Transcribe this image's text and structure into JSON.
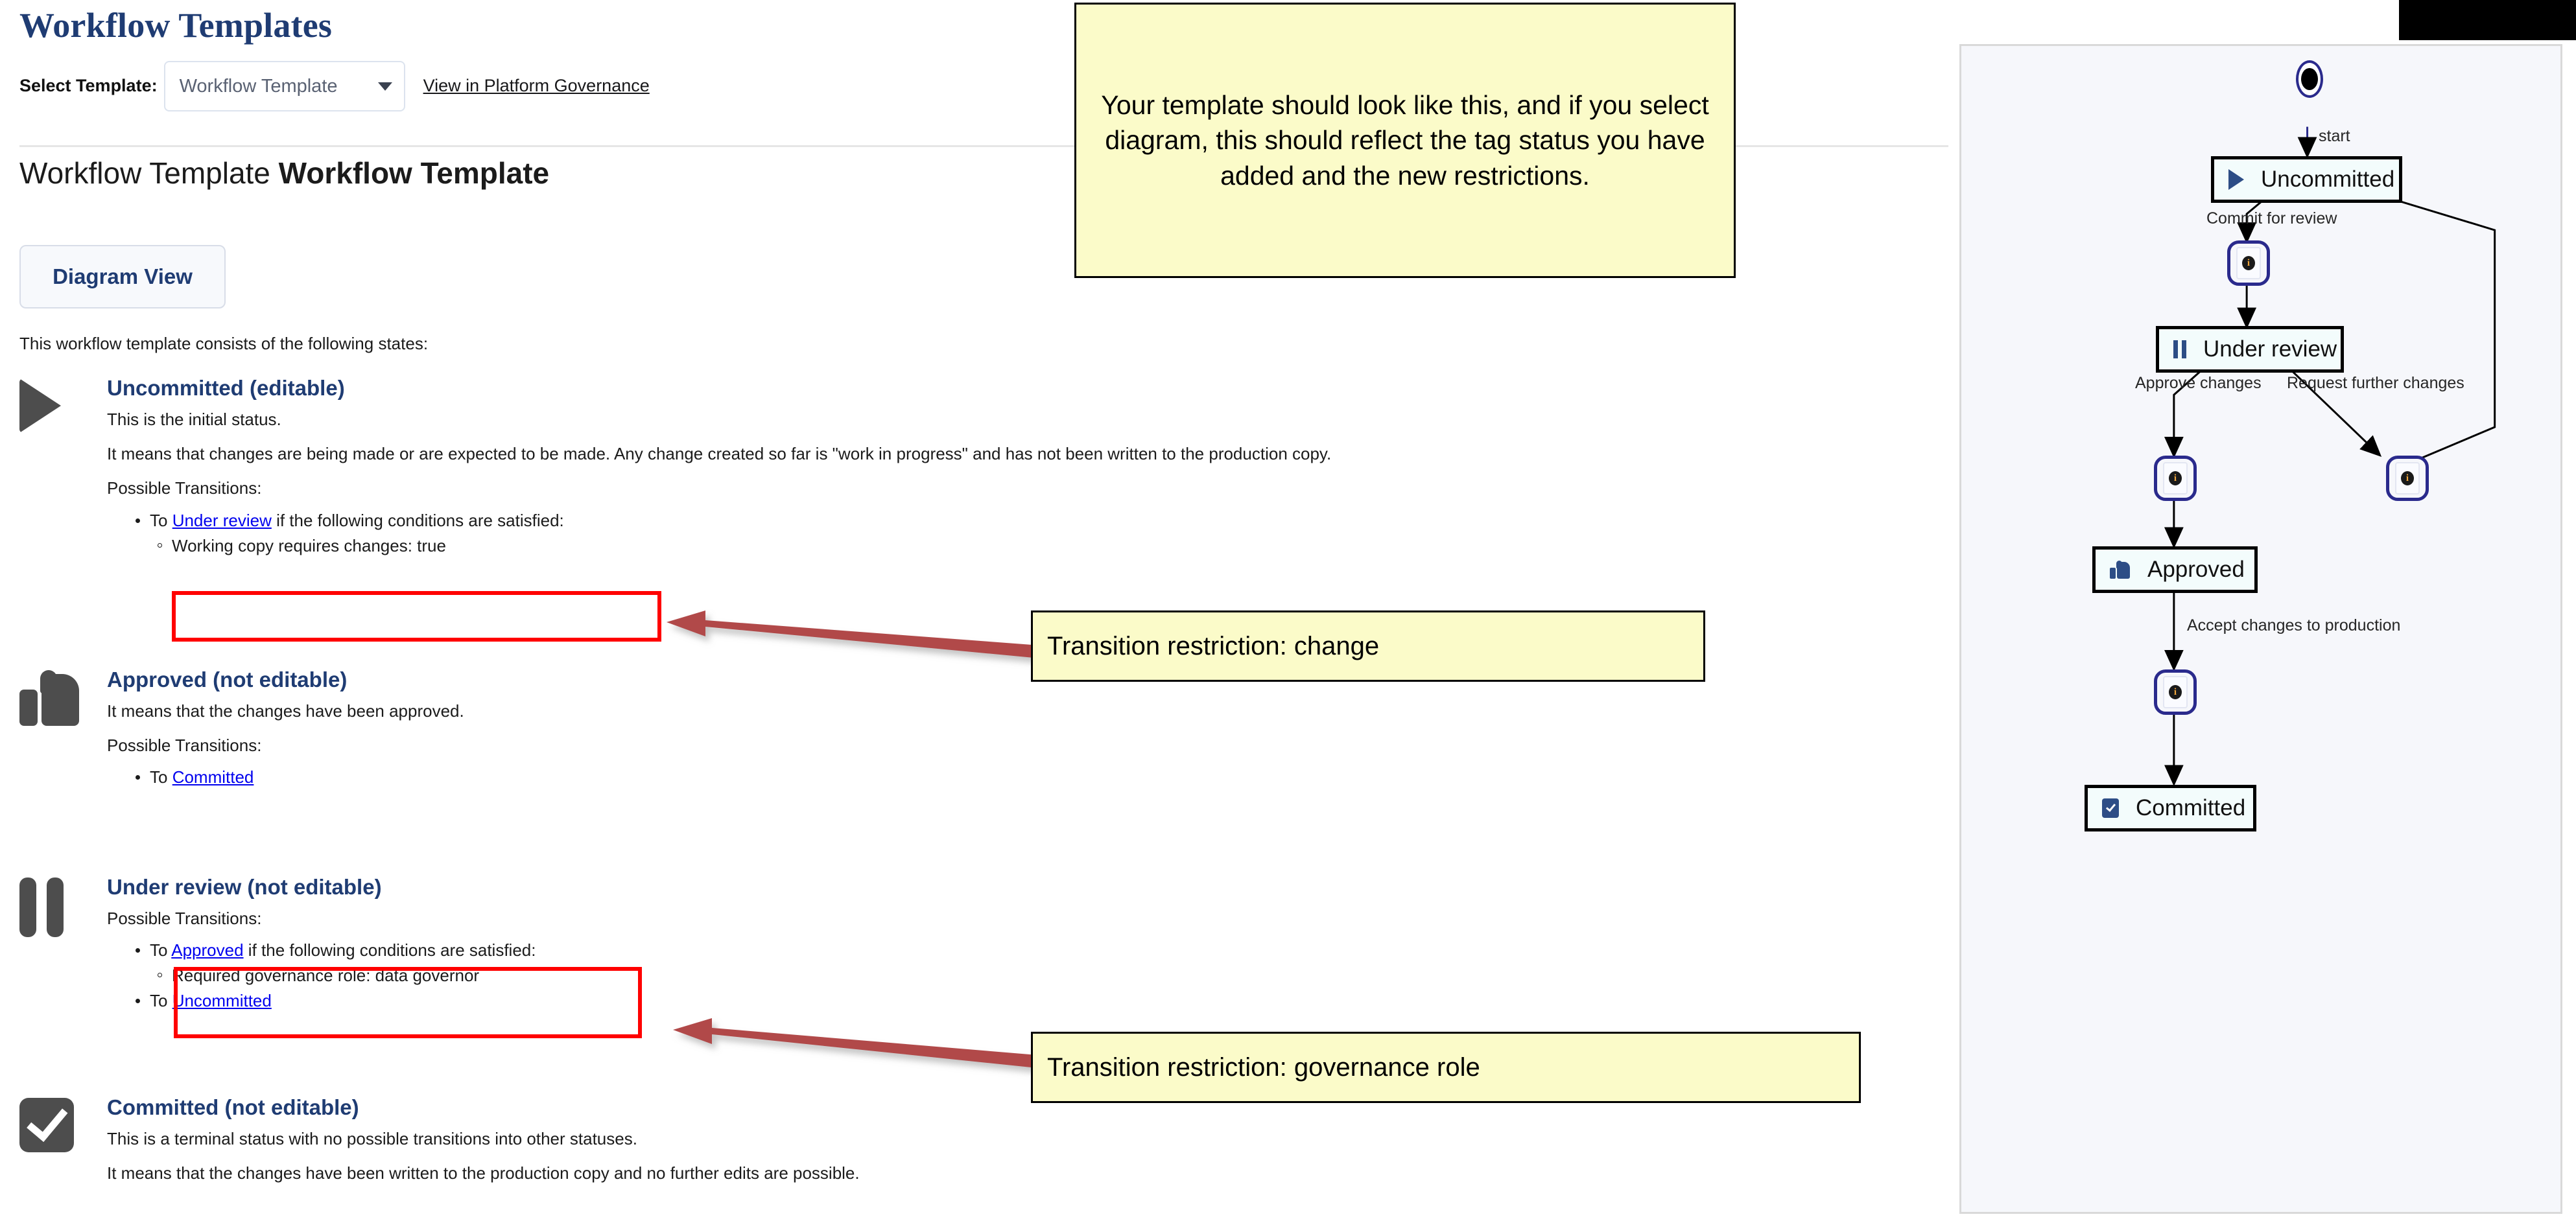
{
  "page": {
    "title": "Workflow Templates",
    "select_label": "Select Template:",
    "select_value": "Workflow Template",
    "gov_link": "View in Platform Governance",
    "heading_prefix": "Workflow Template ",
    "heading_name": "Workflow Template",
    "diagram_button": "Diagram View",
    "intro": "This workflow template consists of the following states:"
  },
  "states": [
    {
      "icon": "play-icon",
      "name": "Uncommitted (editable)",
      "paragraphs": [
        "This is the initial status.",
        "It means that changes are being made or are expected to be made. Any change created so far is \"work in progress\" and has not been written to the production copy."
      ],
      "transitions_label": "Possible Transitions:",
      "transitions": [
        {
          "prefix": "To ",
          "target": "Under review",
          "suffix": " if the following conditions are satisfied:",
          "conditions": [
            "Working copy requires changes: true"
          ],
          "highlighted": true
        }
      ]
    },
    {
      "icon": "thumbs-up-icon",
      "name": "Approved (not editable)",
      "paragraphs": [
        "It means that the changes have been approved."
      ],
      "transitions_label": "Possible Transitions:",
      "transitions": [
        {
          "prefix": "To ",
          "target": "Committed",
          "suffix": "",
          "conditions": [],
          "highlighted": false
        }
      ]
    },
    {
      "icon": "pause-icon",
      "name": "Under review (not editable)",
      "paragraphs": [],
      "transitions_label": "Possible Transitions:",
      "transitions": [
        {
          "prefix": "To ",
          "target": "Approved",
          "suffix": " if the following conditions are satisfied:",
          "conditions": [
            "Required governance role: data governor"
          ],
          "highlighted": true
        },
        {
          "prefix": "To ",
          "target": "Uncommitted",
          "suffix": "",
          "conditions": [],
          "highlighted": false
        }
      ]
    },
    {
      "icon": "checkbox-icon",
      "name": "Committed (not editable)",
      "paragraphs": [
        "This is a terminal status with no possible transitions into other statuses.",
        "It means that the changes have been written to the production copy and no further edits are possible."
      ],
      "transitions_label": "",
      "transitions": []
    }
  ],
  "annotations": {
    "main_note": "Your template should look like this, and if you select diagram, this should reflect the tag status you have added and the new restrictions.",
    "callout_change": "Transition restriction: change",
    "callout_role": "Transition restriction: governance role"
  },
  "diagram": {
    "start_label": "start",
    "nodes": [
      {
        "id": "uncommitted",
        "label": "Uncommitted",
        "icon": "play-icon"
      },
      {
        "id": "under-review",
        "label": "Under review",
        "icon": "pause-icon"
      },
      {
        "id": "approved",
        "label": "Approved",
        "icon": "thumbs-up-icon"
      },
      {
        "id": "committed",
        "label": "Committed",
        "icon": "checkbox-icon"
      }
    ],
    "restriction_nodes": [
      {
        "id": "restr-commit",
        "icon": "info-icon"
      },
      {
        "id": "restr-approve",
        "icon": "info-icon"
      },
      {
        "id": "restr-request",
        "icon": "info-icon"
      },
      {
        "id": "restr-accept",
        "icon": "info-icon"
      }
    ],
    "edges": [
      {
        "label": "Commit for review"
      },
      {
        "label": "Approve changes"
      },
      {
        "label": "Request further changes"
      },
      {
        "label": "Accept changes to production"
      }
    ]
  },
  "colors": {
    "brand_blue": "#1f3c73",
    "highlight_red": "#ff0000",
    "callout_bg": "#fbfbc9",
    "arrow_red": "#b14a4a",
    "node_border": "#2a2a8c",
    "panel_bg": "#f6f7fb"
  }
}
